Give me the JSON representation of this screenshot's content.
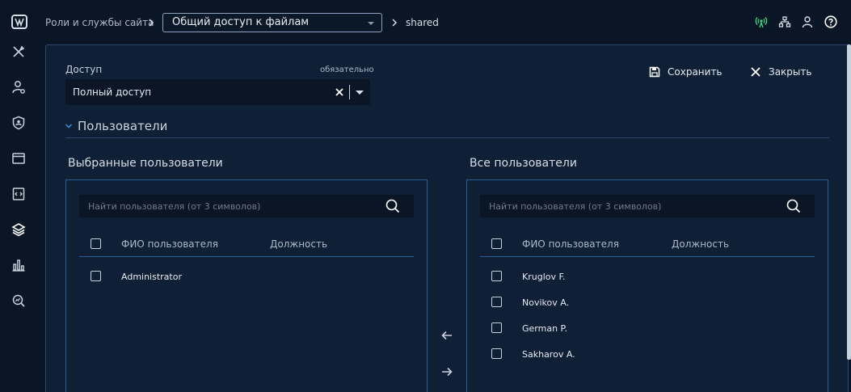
{
  "header": {
    "root_crumb": "Роли и службы сайта",
    "page_selector": "Общий доступ к файлам",
    "current_crumb": "shared"
  },
  "sidenav": {
    "items": [
      "tools-icon",
      "user-settings-icon",
      "shield-icon",
      "window-icon",
      "code-file-icon",
      "layers-icon",
      "bar-chart-icon",
      "search-chart-icon"
    ],
    "active": "layers-icon"
  },
  "form": {
    "access_label": "Доступ",
    "required_label": "обязательно",
    "access_value": "Полный доступ",
    "save_label": "Сохранить",
    "close_label": "Закрыть"
  },
  "section": {
    "title": "Пользователи"
  },
  "selected_users": {
    "heading": "Выбранные пользователи",
    "search_placeholder": "Найти пользователя (от 3 символов)",
    "columns": [
      "ФИО пользователя",
      "Должность"
    ],
    "rows": [
      {
        "name": "Administrator",
        "position": ""
      }
    ]
  },
  "all_users": {
    "heading": "Все пользователи",
    "search_placeholder": "Найти пользователя (от 3 символов)",
    "columns": [
      "ФИО пользователя",
      "Должность"
    ],
    "rows": [
      {
        "name": "Kruglov F.",
        "position": ""
      },
      {
        "name": "Novikov A.",
        "position": ""
      },
      {
        "name": "German P.",
        "position": ""
      },
      {
        "name": "Sakharov A.",
        "position": ""
      }
    ]
  },
  "colors": {
    "background": "#0a1626",
    "panel": "#0f1f36",
    "border": "#2d5c94",
    "status_green": "#3ddc84"
  }
}
